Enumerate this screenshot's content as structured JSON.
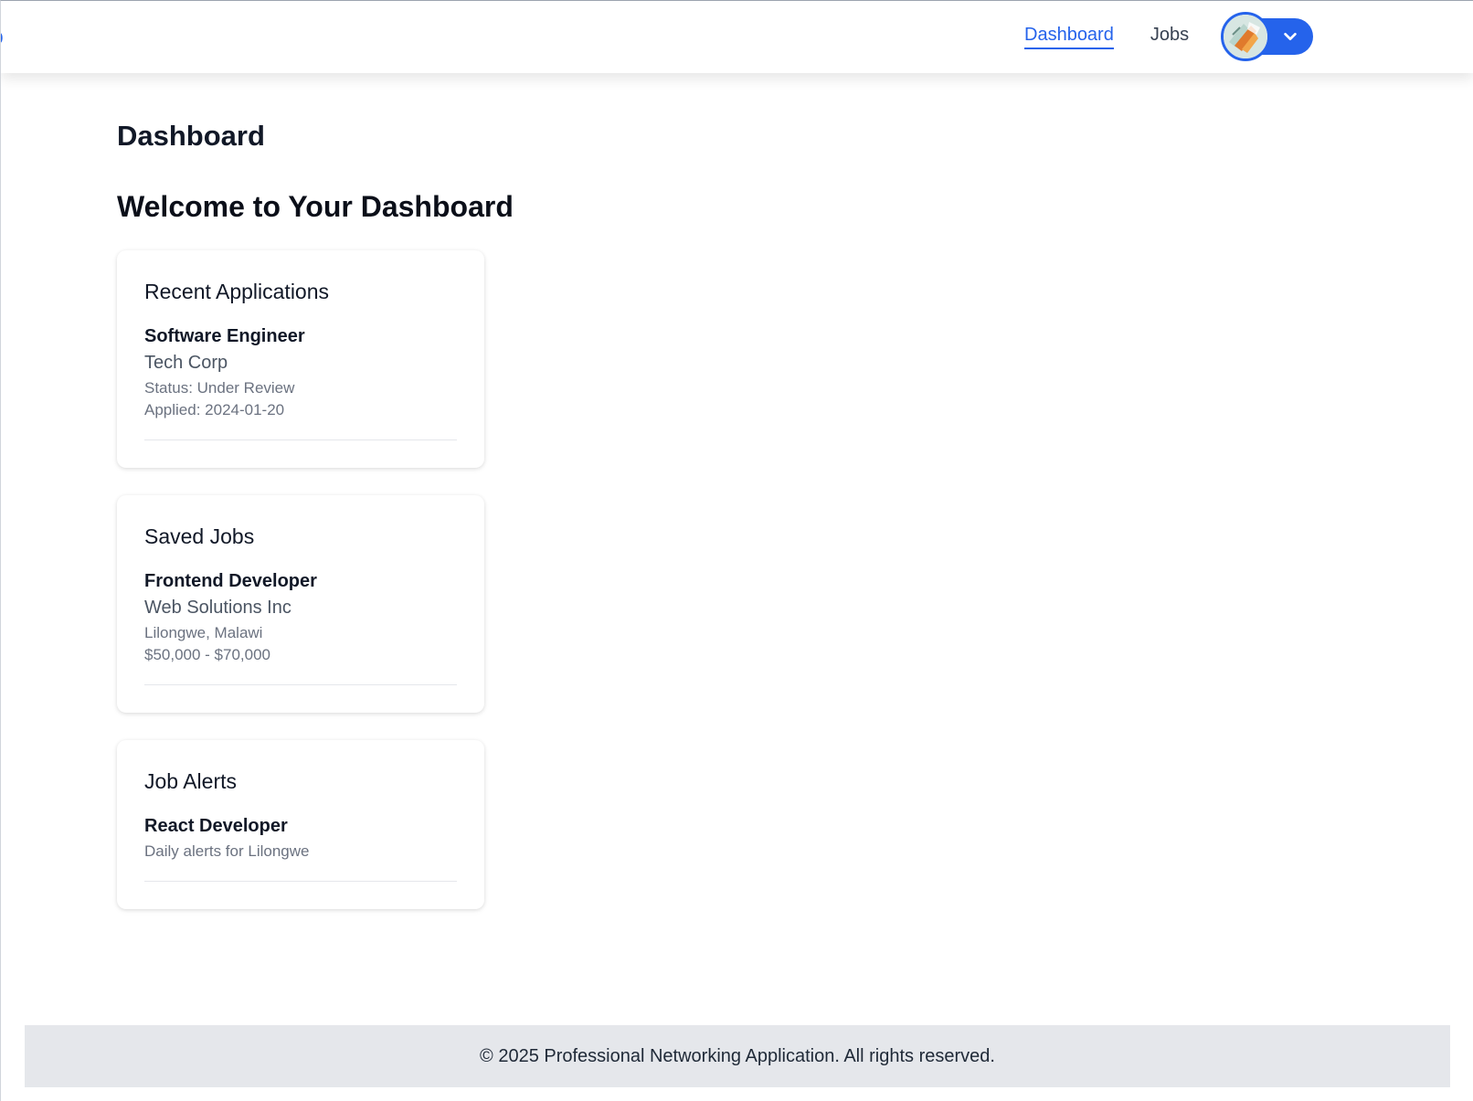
{
  "header": {
    "brand": "p",
    "nav": [
      {
        "label": "Dashboard",
        "active": true
      },
      {
        "label": "Jobs",
        "active": false
      }
    ],
    "accent_color": "#2563eb",
    "user_menu_icon": "chevron-down-icon"
  },
  "main": {
    "page_title": "Dashboard",
    "welcome": "Welcome to Your Dashboard",
    "recent_applications": {
      "title": "Recent Applications",
      "items": [
        {
          "title": "Software Engineer",
          "company": "Tech Corp",
          "status": "Status: Under Review",
          "applied": "Applied: 2024-01-20"
        }
      ]
    },
    "saved_jobs": {
      "title": "Saved Jobs",
      "items": [
        {
          "title": "Frontend Developer",
          "company": "Web Solutions Inc",
          "location": "Lilongwe, Malawi",
          "salary": "$50,000 - $70,000"
        }
      ]
    },
    "job_alerts": {
      "title": "Job Alerts",
      "items": [
        {
          "title": "React Developer",
          "frequency": "Daily alerts for Lilongwe"
        }
      ]
    }
  },
  "footer": {
    "text": "© 2025 Professional Networking Application. All rights reserved."
  }
}
